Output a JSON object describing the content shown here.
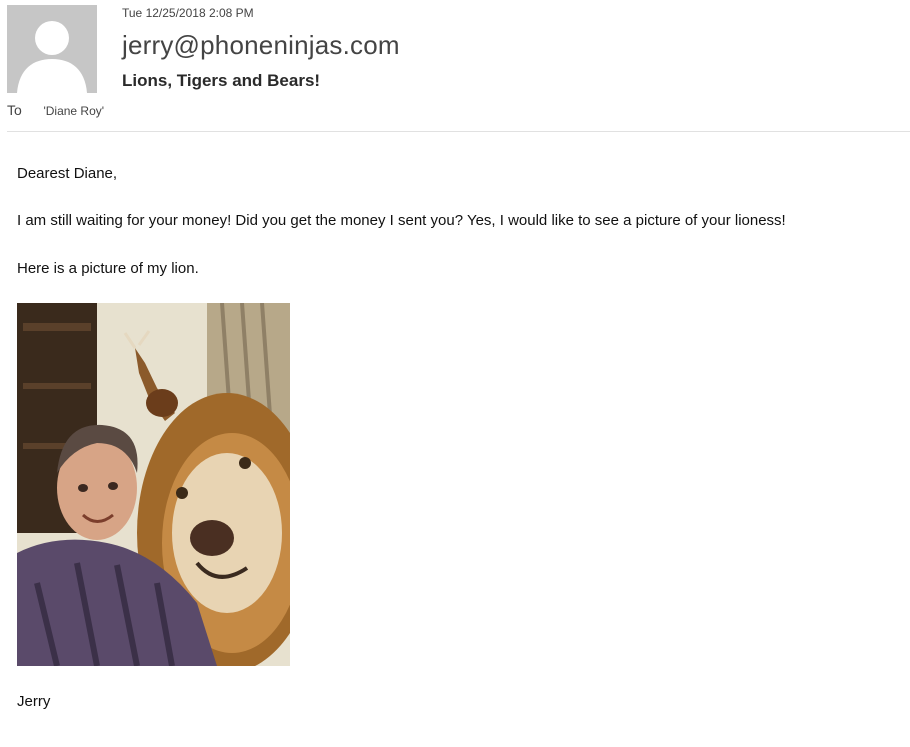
{
  "message": {
    "timestamp": "Tue 12/25/2018 2:08 PM",
    "sender": "jerry@phoneninjas.com",
    "subject": "Lions, Tigers and Bears!",
    "to_label": "To",
    "to_value": "'Diane Roy'"
  },
  "body": {
    "greeting": "Dearest Diane,",
    "paragraph1": "I am still waiting for your money!  Did you get the money I sent you?  Yes, I would like to see a picture of your lioness!",
    "paragraph2": "Here is a picture of my lion.",
    "signature": "Jerry"
  },
  "icons": {
    "avatar": "user-silhouette-icon",
    "photo": "man-with-lion-photo"
  },
  "colors": {
    "avatar_bg": "#c6c6c6",
    "divider": "#e1e1e1",
    "text": "#444444"
  }
}
